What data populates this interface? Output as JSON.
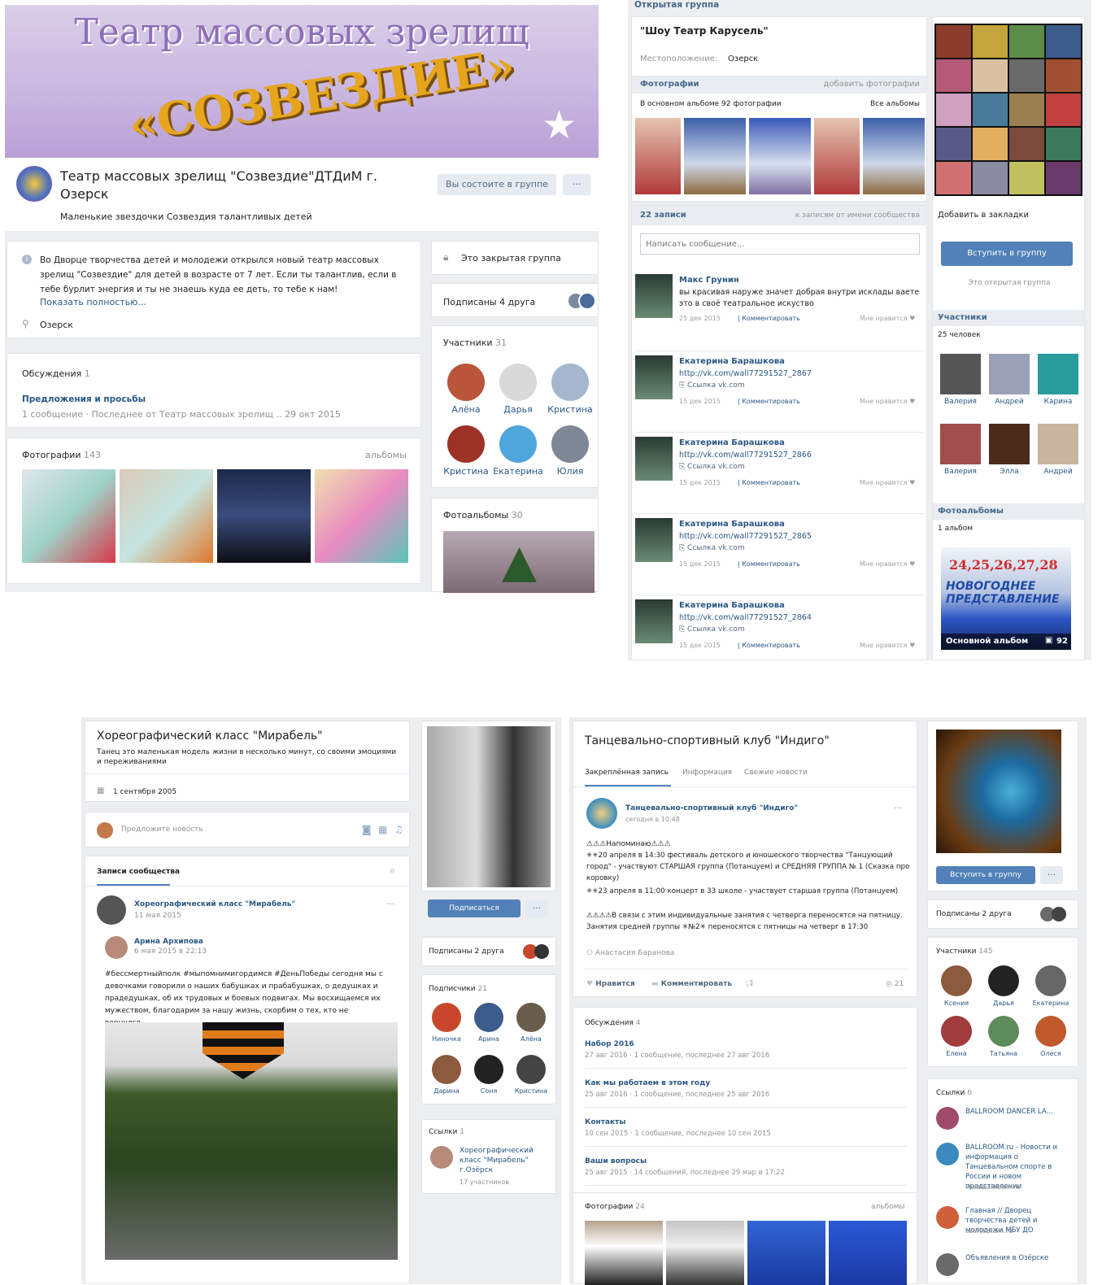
{
  "p1": {
    "banner_line1": "Театр массовых зрелищ",
    "banner_line2": "«СОЗВЕЗДИЕ»",
    "title": "Театр массовых зрелищ \"Созвездие\"ДТДиМ г. Озерск",
    "status": "Маленькие звездочки Созвездия талантливых детей",
    "member_btn": "Вы состоите в группе",
    "more": "···",
    "desc": "Во Дворце творчества детей и молодежи открылся новый театр массовых зрелищ \"Созвездие\" для детей в возрасте от 7 лет. Если ты талантлив, если в тебе бурлит энергия и ты не знаешь куда ее деть, то тебе к нам!",
    "show_full": "Показать полностью...",
    "location": "Озерск",
    "closed": "Это закрытая группа",
    "friends": "Подписаны 4 друга",
    "members_label": "Участники",
    "members_count": "31",
    "members": [
      {
        "name": "Алёна",
        "color": "#b8553a"
      },
      {
        "name": "Дарья",
        "color": "#d9d9d9"
      },
      {
        "name": "Кристина",
        "color": "#a5b6cf"
      },
      {
        "name": "Кристина",
        "color": "#9c3326"
      },
      {
        "name": "Екатерина",
        "color": "#4ea6dc"
      },
      {
        "name": "Юлия",
        "color": "#7d8796"
      }
    ],
    "disc_label": "Обсуждения",
    "disc_count": "1",
    "topic": "Предложения и просьбы",
    "topic_meta": "1 сообщение · Последнее от Театр массовых зрелищ .. 29 окт 2015",
    "photos_label": "Фотографии",
    "photos_count": "143",
    "albums": "альбомы",
    "albums_label": "Фотоальбомы",
    "albums_count": "30"
  },
  "p2": {
    "open_group": "Открытая группа",
    "title": "\"Шоу Театр Карусель\"",
    "location_label": "Местоположение:",
    "location": "Озерск",
    "photos": "Фотографии",
    "add_photos": "добавить фотографии",
    "album_info": "В основном альбоме 92 фотографии",
    "all_albums": "Все альбомы",
    "posts": "22 записи",
    "posts_filter": "к записям от имени сообщества",
    "placeholder": "Написать сообщение...",
    "bookmark": "Добавить в закладки",
    "join": "Вступить в группу",
    "open_note": "Это открытая группа",
    "members_label": "Участники",
    "members_count": "25 человек",
    "members": [
      {
        "name": "Валерия",
        "color": "#555"
      },
      {
        "name": "Андрей",
        "color": "#9aa0b5"
      },
      {
        "name": "Карина",
        "color": "#2a9c9c"
      },
      {
        "name": "Валерия",
        "color": "#a24d4d"
      },
      {
        "name": "Элла",
        "color": "#4b2c1c"
      },
      {
        "name": "Андрей",
        "color": "#c8b4a0"
      }
    ],
    "albums_label": "Фотоальбомы",
    "albums_count": "1 альбом",
    "album_name": "Основной альбом",
    "album_n": "92",
    "album_cover": "24,25,26,27,28",
    "album_cover2": "НОВОГОДНЕЕ ПРЕДСТАВЛЕНИЕ",
    "wall": [
      {
        "author": "Макс Грунин",
        "text": "вы красивая наруже значет добрая внутри исклады ваете это в своё театральное искуство",
        "date": "25 дек 2015",
        "comment": "Комментировать",
        "like": "Мне нравится"
      },
      {
        "author": "Екатерина Барашкова",
        "text": "http://vk.com/wall77291527_2867",
        "link": "Ссылка vk.com",
        "date": "15 дек 2015",
        "comment": "Комментировать",
        "like": "Мне нравится"
      },
      {
        "author": "Екатерина Барашкова",
        "text": "http://vk.com/wall77291527_2866",
        "link": "Ссылка vk.com",
        "date": "15 дек 2015",
        "comment": "Комментировать",
        "like": "Мне нравится"
      },
      {
        "author": "Екатерина Барашкова",
        "text": "http://vk.com/wall77291527_2865",
        "link": "Ссылка vk.com",
        "date": "15 дек 2015",
        "comment": "Комментировать",
        "like": "Мне нравится"
      },
      {
        "author": "Екатерина Барашкова",
        "text": "http://vk.com/wall77291527_2864",
        "link": "Ссылка vk.com",
        "date": "15 дек 2015",
        "comment": "Комментировать",
        "like": "Мне нравится"
      }
    ]
  },
  "p3": {
    "title": "Хореографический класс \"Мирабель\"",
    "status": "Танец это маленькая модель жизни в несколько минут, со своими эмоциями и переживаниями",
    "date": "1 сентября 2005",
    "suggest": "Предложите новость",
    "wall_tab": "Записи сообщества",
    "post_author": "Хореографический класс \"Мирабель\"",
    "post_date": "11 мая 2015",
    "repost_author": "Арина Архипова",
    "repost_date": "6 мая 2015 в 22:13",
    "post_text": "#бессмертныйполк #мыпомнимигордимся #ДеньПобеды сегодня мы с девочками говорили о наших бабушках и прабабушках, о дедушках и прадедушках, об их трудовых и боевых подвигах. Мы восхищаемся их мужеством, благодарим за нашу жизнь, скорбим о тех, кто не вернулся...",
    "subscribe": "Подписаться",
    "friends": "Подписаны 2 друга",
    "subs_label": "Подписчики",
    "subs_count": "21",
    "subs": [
      {
        "name": "Ниночка",
        "color": "#c8472c"
      },
      {
        "name": "Арина",
        "color": "#3c5a8c"
      },
      {
        "name": "Алёна",
        "color": "#6a5c4a"
      },
      {
        "name": "Дарина",
        "color": "#8c5a3c"
      },
      {
        "name": "Соня",
        "color": "#222"
      },
      {
        "name": "Кристина",
        "color": "#444"
      }
    ],
    "links_label": "Ссылки",
    "links_count": "1",
    "link_title": "Хореографический класс \"Мирабель\" г.Озёрск",
    "link_sub": "17 участников"
  },
  "p4": {
    "title": "Танцевально-спортивный клуб \"Индиго\"",
    "tabs": [
      "Закреплённая запись",
      "Информация",
      "Свежие новости"
    ],
    "post_author": "Танцевально-спортивный клуб \"Индиго\"",
    "post_time": "сегодня в 10:48",
    "post_l1": "⚠⚠⚠Напоминаю⚠⚠⚠",
    "post_l2": "✳✳20 апреля в 14:30 фестиваль детского и юношеского творчества \"Танцующий город\" - участвуют СТАРШАЯ группа (Потанцуем) и СРЕДНЯЯ ГРУППА № 1 (Сказка про коровку)",
    "post_l3": "✳✳23 апреля в 11:00 концерт в 33 школе - участвует старшая группа (Потанцуем)",
    "post_l4": "⚠⚠⚠⚠В связи с этим индивидуальные занятия с четверга переносятся на пятницу. Занятия средней группы ✳№2✳ переносятся с пятницы на четверг в 17:30",
    "signer": "Анастасия Баранова",
    "like": "Нравится",
    "comment": "Комментировать",
    "views": "21",
    "join": "Вступить в группу",
    "friends": "Подписаны 2 друга",
    "members_label": "Участники",
    "members_count": "145",
    "members": [
      {
        "name": "Ксения",
        "color": "#8c5a3c"
      },
      {
        "name": "Дарья",
        "color": "#222"
      },
      {
        "name": "Екатерина",
        "color": "#666"
      },
      {
        "name": "Елена",
        "color": "#a03c3c"
      },
      {
        "name": "Татьяна",
        "color": "#5c8c5c"
      },
      {
        "name": "Олеся",
        "color": "#c05a2a"
      }
    ],
    "disc_label": "Обсуждения",
    "disc_count": "4",
    "topics": [
      {
        "title": "Набор 2016",
        "meta": "27 авг 2016 · 1 сообщение, последнее 27 авг 2016"
      },
      {
        "title": "Как мы работаем в этом году",
        "meta": "25 авг 2016 · 1 сообщение, последнее 25 авг 2016"
      },
      {
        "title": "Контакты",
        "meta": "10 сен 2015 · 1 сообщение, последнее 10 сен 2015"
      },
      {
        "title": "Ваши вопросы",
        "meta": "25 авг 2015 · 14 сообщений, последнее 29 мар в 17:22"
      }
    ],
    "photos_label": "Фотографии",
    "photos_count": "24",
    "albums": "альбомы",
    "links_label": "Ссылки",
    "links_count": "6",
    "links": [
      {
        "title": "BALLROOM DANCER LA...",
        "sub": ""
      },
      {
        "title": "BALLROOM.ru - Новости и информация о Танцевальном спорте в России и новом представлении",
        "sub": "www.ballroom.ru"
      },
      {
        "title": "Главная // Дворец творчества детей и молодежи МБУ ДО",
        "sub": "ozerskdtdm.ru"
      },
      {
        "title": "Объявления в Озёрске",
        "sub": ""
      }
    ]
  }
}
